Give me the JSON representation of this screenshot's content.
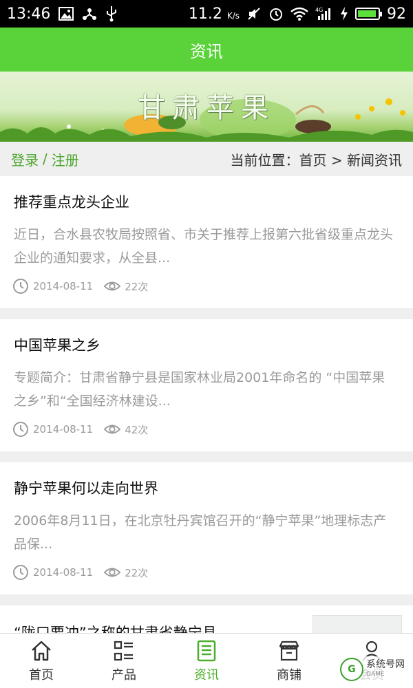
{
  "status_bar": {
    "time": "13:46",
    "network_speed": "11.2",
    "speed_unit": "K/s",
    "battery_level": "92",
    "battery_fraction": 0.92
  },
  "header": {
    "title": "资讯"
  },
  "banner": {
    "title": "甘肃苹果"
  },
  "breadcrumb": {
    "login_label": "登录",
    "separator": "/",
    "register_label": "注册",
    "position_label": "当前位置：首页 > 新闻资讯"
  },
  "news": [
    {
      "title": "推荐重点龙头企业",
      "summary": "近日，合水县农牧局按照省、市关于推荐上报第六批省级重点龙头企业的通知要求，从全县...",
      "date": "2014-08-11",
      "views": "22次"
    },
    {
      "title": "中国苹果之乡",
      "summary": "专题简介：甘肃省静宁县是国家林业局2001年命名的 “中国苹果之乡”和“全国经济林建设...",
      "date": "2014-08-11",
      "views": "42次"
    },
    {
      "title": "静宁苹果何以走向世界",
      "summary": " 2006年8月11日，在北京牡丹宾馆召开的“静宁苹果”地理标志产品保...",
      "date": "2014-08-11",
      "views": "22次"
    },
    {
      "title": "“陇口要冲”之称的甘肃省静宁县"
    }
  ],
  "tabs": [
    {
      "label": "首页",
      "icon": "home-icon"
    },
    {
      "label": "产品",
      "icon": "grid-list-icon"
    },
    {
      "label": "资讯",
      "icon": "news-icon"
    },
    {
      "label": "商铺",
      "icon": "shop-icon"
    },
    {
      "label": "会员",
      "icon": "user-icon"
    }
  ],
  "watermark": {
    "text": "系统号网",
    "sub": "GAME"
  },
  "colors": {
    "accent": "#5ad23a",
    "active_tab": "#4aae2a",
    "link_green": "#4aa52c",
    "muted_text": "#9a9a9a",
    "divider": "#efefef"
  }
}
